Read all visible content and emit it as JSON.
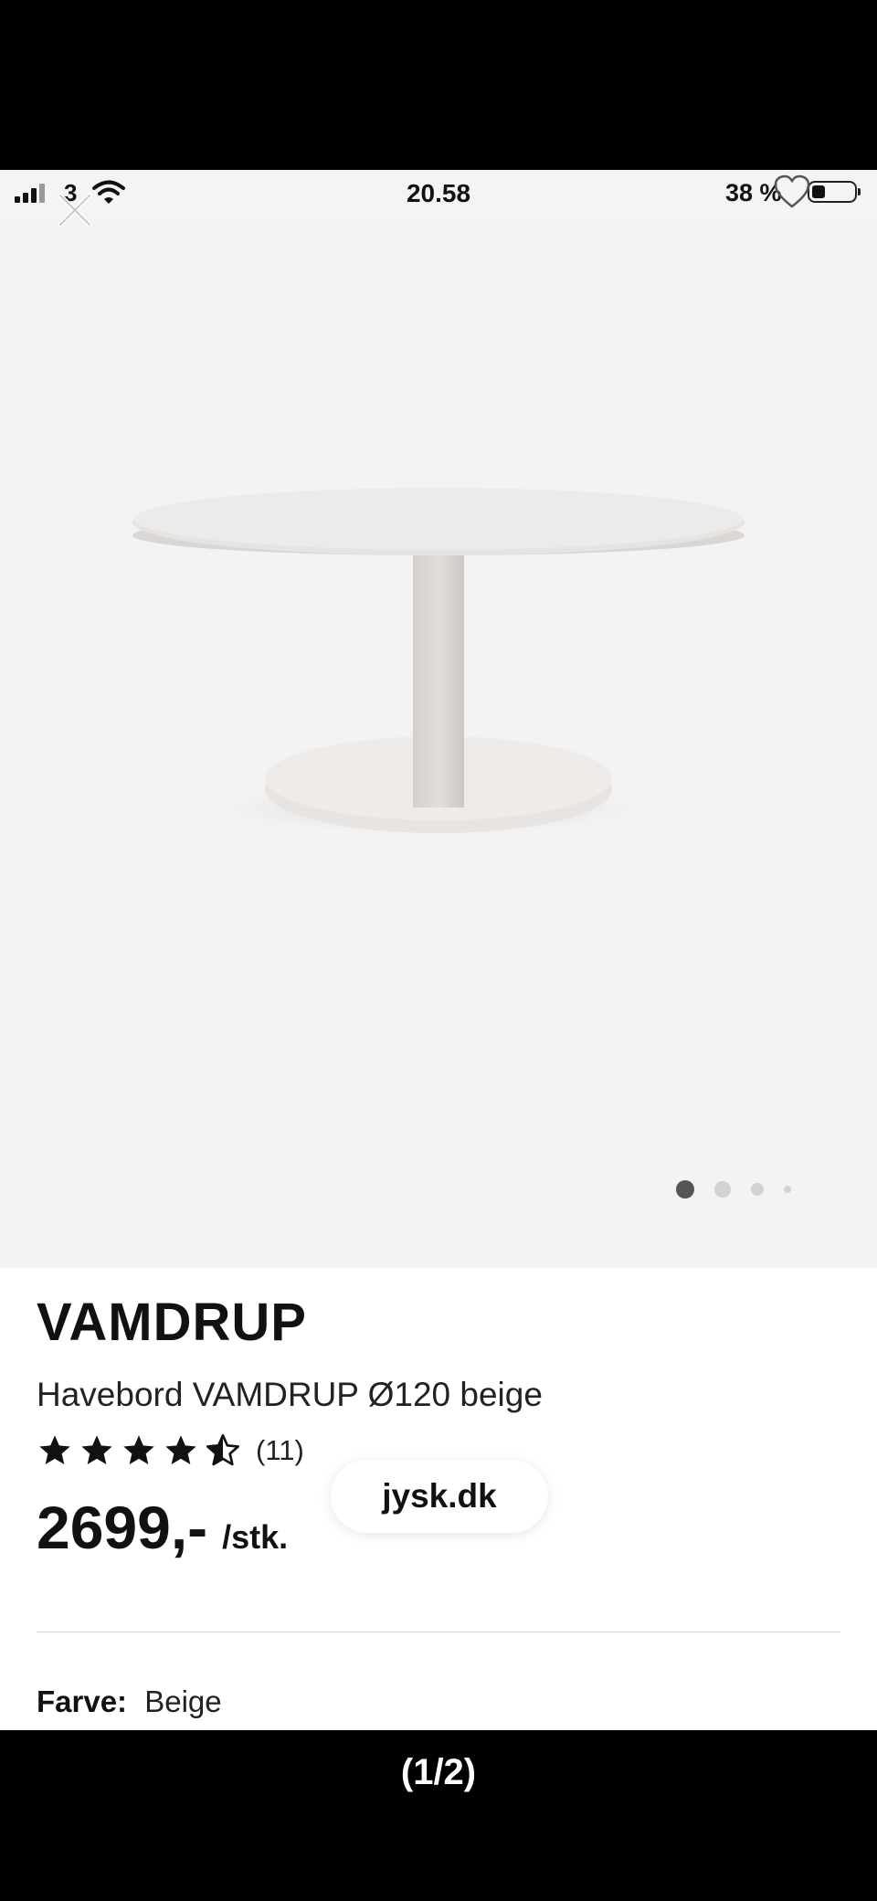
{
  "status_bar": {
    "carrier": "3",
    "time": "20.58",
    "battery": "38 %"
  },
  "icons": {
    "close": "close-icon",
    "favorite": "heart-icon",
    "wifi": "wifi-icon",
    "signal": "signal-icon",
    "battery": "battery-icon"
  },
  "gallery": {
    "total_images": 4,
    "active_index": 0
  },
  "product": {
    "brand": "VAMDRUP",
    "name": "Havebord VAMDRUP Ø120 beige",
    "rating": 4.5,
    "max_rating": 5,
    "review_count": "(11)",
    "price": "2699,-",
    "price_unit": "/stk.",
    "color_label": "Farve:",
    "color_value": "Beige"
  },
  "browser": {
    "url": "jysk.dk"
  },
  "viewer": {
    "pager": "(1/2)"
  }
}
